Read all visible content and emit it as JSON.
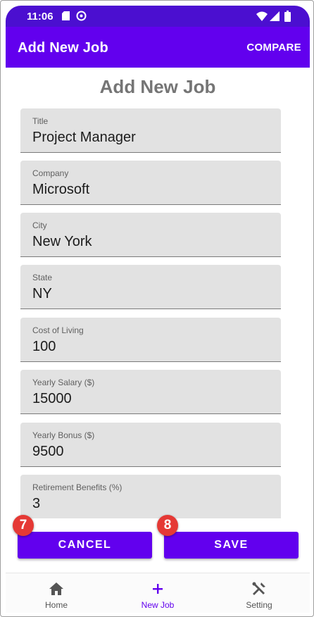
{
  "status_bar": {
    "time": "11:06"
  },
  "app_bar": {
    "title": "Add New Job",
    "compare_label": "COMPARE"
  },
  "page": {
    "heading": "Add New Job"
  },
  "fields": [
    {
      "label": "Title",
      "value": "Project Manager"
    },
    {
      "label": "Company",
      "value": "Microsoft"
    },
    {
      "label": "City",
      "value": "New York"
    },
    {
      "label": "State",
      "value": "NY"
    },
    {
      "label": "Cost of Living",
      "value": "100"
    },
    {
      "label": "Yearly Salary ($)",
      "value": "15000"
    },
    {
      "label": "Yearly Bonus ($)",
      "value": "9500"
    },
    {
      "label": "Retirement Benefits (%)",
      "value": "3"
    }
  ],
  "buttons": {
    "cancel_label": "CANCEL",
    "save_label": "SAVE"
  },
  "markers": {
    "cancel": "7",
    "save": "8"
  },
  "bottom_nav": {
    "items": [
      {
        "label": "Home",
        "icon": "home-icon"
      },
      {
        "label": "New Job",
        "icon": "plus-icon"
      },
      {
        "label": "Setting",
        "icon": "tools-icon"
      }
    ],
    "active": "New Job"
  },
  "colors": {
    "primary": "#6200ee",
    "status_bar": "#4b0fd0",
    "field_bg": "#e2e2e2",
    "heading": "#757575",
    "marker": "#e53935"
  }
}
